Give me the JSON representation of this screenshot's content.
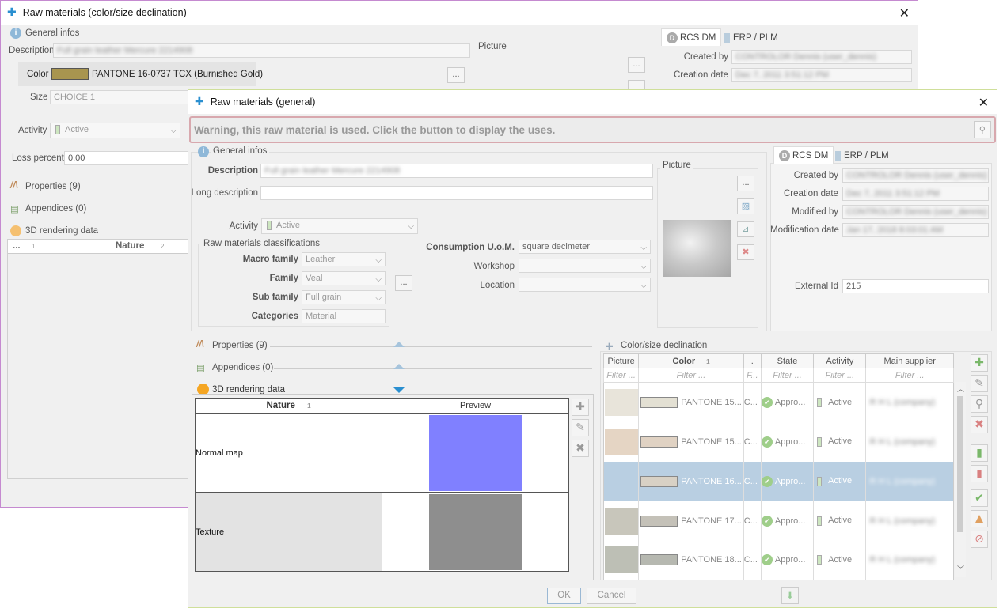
{
  "back": {
    "title": "Raw materials (color/size declination)",
    "general_infos": "General infos",
    "description_label": "Description",
    "description_value": "Full grain leather Mercure 2214908",
    "color_label": "Color",
    "color_value": "PANTONE 16-0737 TCX (Burnished Gold)",
    "color_swatch": "#a8954f",
    "size_label": "Size",
    "size_value": "CHOICE 1",
    "activity_label": "Activity",
    "activity_value": "Active",
    "loss_label": "Loss percent",
    "loss_value": "0.00",
    "picture_label": "Picture",
    "tab_rcs": "RCS DM",
    "tab_erp": "ERP / PLM",
    "created_by_label": "Created by",
    "created_by_value": "CONTROLOR Dennis (user_dennis)",
    "creation_date_label": "Creation date",
    "creation_date_value": "Dec 7, 2011 3:51:12 PM",
    "properties": "Properties (9)",
    "appendices": "Appendices (0)",
    "rendering": "3D rendering data",
    "col_sort1": "...",
    "col_nature": "Nature",
    "sort1": "1",
    "sort2": "2",
    "more_btn": "..."
  },
  "front": {
    "title": "Raw materials (general)",
    "warning": "Warning, this raw material is used. Click the button to display the uses.",
    "general_infos": "General infos",
    "description_label": "Description",
    "description_value": "Full grain leather Mercure 2214908",
    "long_description_label": "Long description",
    "activity_label": "Activity",
    "activity_value": "Active",
    "classifications_label": "Raw materials classifications",
    "macro_family_label": "Macro family",
    "macro_family_value": "Leather",
    "family_label": "Family",
    "family_value": "Veal",
    "sub_family_label": "Sub family",
    "sub_family_value": "Full grain",
    "categories_label": "Categories",
    "categories_value": "Material",
    "more_btn": "...",
    "consumption_label": "Consumption U.o.M.",
    "consumption_value": "square decimeter",
    "workshop_label": "Workshop",
    "location_label": "Location",
    "picture_label": "Picture",
    "tab_rcs": "RCS DM",
    "tab_erp": "ERP / PLM",
    "created_by_label": "Created by",
    "created_by_value": "CONTROLOR Dennis (user_dennis)",
    "creation_date_label": "Creation date",
    "creation_date_value": "Dec 7, 2011 3:51:12 PM",
    "modified_by_label": "Modified by",
    "modified_by_value": "CONTROLOR Dennis (user_dennis)",
    "modification_date_label": "Modification date",
    "modification_date_value": "Jan 17, 2018 8:03:01 AM",
    "external_id_label": "External Id",
    "external_id_value": "215",
    "properties": "Properties (9)",
    "appendices": "Appendices (0)",
    "rendering": "3D rendering data",
    "render_table": {
      "col_nature": "Nature",
      "col_preview": "Preview",
      "sort": "1",
      "rows": [
        {
          "nature": "Normal map",
          "color": "#8080ff"
        },
        {
          "nature": "Texture",
          "color": "#8e8e8e"
        }
      ]
    },
    "decl": {
      "label": "Color/size declination",
      "cols": [
        "Picture",
        "Color",
        ".",
        "State",
        "Activity",
        "Main supplier"
      ],
      "sort": "1",
      "filters": [
        "Filter ...",
        "Filter ...",
        "F...",
        "Filter ...",
        "Filter ...",
        "Filter ..."
      ],
      "rows": [
        {
          "pic": "#e8e4da",
          "swatch": "#e3e0d3",
          "color": "PANTONE 15...",
          "c": "C...",
          "state": "Appro...",
          "activity": "Active",
          "supplier": "R H L (company)"
        },
        {
          "pic": "#e5d5c4",
          "swatch": "#e0d2c3",
          "color": "PANTONE 15...",
          "c": "C...",
          "state": "Appro...",
          "activity": "Active",
          "supplier": "R H L (company)"
        },
        {
          "pic": "#b8cfe0",
          "swatch": "#d8d1c5",
          "color": "PANTONE 16...",
          "c": "C...",
          "state": "Appro...",
          "activity": "Active",
          "supplier": "R H L (company)"
        },
        {
          "pic": "#c8c6bb",
          "swatch": "#c4c1b8",
          "color": "PANTONE 17...",
          "c": "C...",
          "state": "Appro...",
          "activity": "Active",
          "supplier": "R H L (company)"
        },
        {
          "pic": "#bdbfb5",
          "swatch": "#b6b8b0",
          "color": "PANTONE 18...",
          "c": "C...",
          "state": "Appro...",
          "activity": "Active",
          "supplier": "R H L (company)"
        }
      ]
    },
    "ok": "OK",
    "cancel": "Cancel"
  }
}
